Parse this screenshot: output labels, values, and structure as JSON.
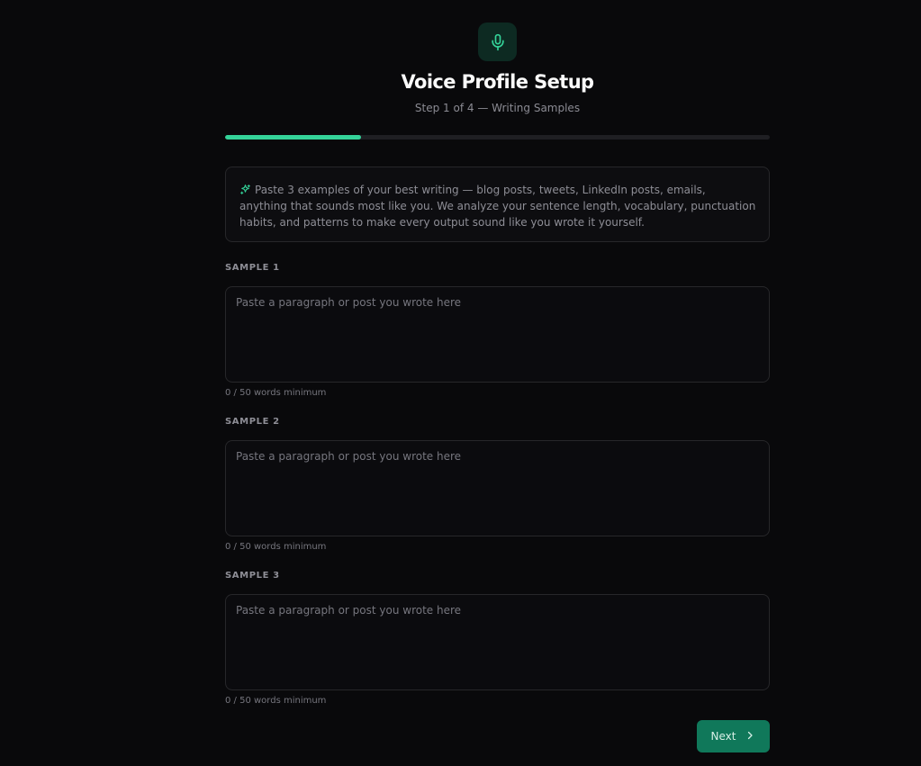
{
  "header": {
    "icon": "microphone-icon",
    "title": "Voice Profile Setup",
    "subtitle": "Step 1 of 4 — Writing Samples"
  },
  "progress": {
    "current_step": 1,
    "total_steps": 4,
    "fraction": 0.25,
    "color": "#34d399"
  },
  "info": {
    "icon": "sparkle-icon",
    "text": "Paste 3 examples of your best writing — blog posts, tweets, LinkedIn posts, emails, anything that sounds most like you. We analyze your sentence length, vocabulary, punctuation habits, and patterns to make every output sound like you wrote it yourself."
  },
  "samples": [
    {
      "label": "SAMPLE 1",
      "value": "",
      "placeholder": "Paste a paragraph or post you wrote here",
      "word_count": "0 / 50 words minimum"
    },
    {
      "label": "SAMPLE 2",
      "value": "",
      "placeholder": "Paste a paragraph or post you wrote here",
      "word_count": "0 / 50 words minimum"
    },
    {
      "label": "SAMPLE 3",
      "value": "",
      "placeholder": "Paste a paragraph or post you wrote here",
      "word_count": "0 / 50 words minimum"
    }
  ],
  "footer": {
    "next_label": "Next",
    "next_icon": "chevron-right-icon"
  },
  "colors": {
    "accent": "#34d399",
    "button": "#10785a",
    "background": "#09090b"
  }
}
